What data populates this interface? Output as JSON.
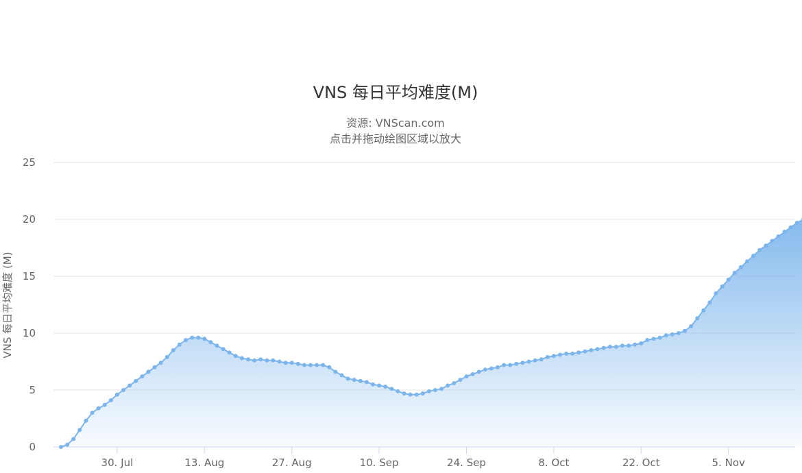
{
  "chart_data": {
    "type": "area",
    "title": "VNS 每日平均难度(M)",
    "subtitle_lines": [
      "资源: VNScan.com",
      "点击并拖动绘图区域以放大"
    ],
    "ylabel": "VNS 每日平均难度 (M)",
    "xlabel": "",
    "ylim": [
      0,
      25
    ],
    "yticks": [
      "0",
      "5",
      "10",
      "15",
      "20",
      "25"
    ],
    "xticks": [
      {
        "label": "30. Jul",
        "day": 9
      },
      {
        "label": "13. Aug",
        "day": 23
      },
      {
        "label": "27. Aug",
        "day": 37
      },
      {
        "label": "10. Sep",
        "day": 51
      },
      {
        "label": "24. Sep",
        "day": 65
      },
      {
        "label": "8. Oct",
        "day": 79
      },
      {
        "label": "22. Oct",
        "day": 93
      },
      {
        "label": "5. Nov",
        "day": 107
      }
    ],
    "grid": true,
    "legend": "none",
    "series": [
      {
        "values": [
          0.0,
          0.2,
          0.7,
          1.5,
          2.3,
          3.0,
          3.4,
          3.7,
          4.1,
          4.6,
          5.0,
          5.4,
          5.8,
          6.2,
          6.6,
          7.0,
          7.4,
          7.9,
          8.5,
          9.0,
          9.4,
          9.6,
          9.6,
          9.5,
          9.2,
          8.9,
          8.6,
          8.3,
          8.0,
          7.8,
          7.7,
          7.6,
          7.7,
          7.6,
          7.6,
          7.5,
          7.4,
          7.4,
          7.3,
          7.2,
          7.2,
          7.2,
          7.2,
          7.0,
          6.6,
          6.3,
          6.0,
          5.9,
          5.8,
          5.7,
          5.5,
          5.4,
          5.3,
          5.1,
          4.9,
          4.7,
          4.6,
          4.6,
          4.7,
          4.9,
          5.0,
          5.1,
          5.4,
          5.6,
          5.9,
          6.2,
          6.4,
          6.6,
          6.8,
          6.9,
          7.0,
          7.2,
          7.2,
          7.3,
          7.4,
          7.5,
          7.6,
          7.7,
          7.9,
          8.0,
          8.1,
          8.2,
          8.2,
          8.3,
          8.4,
          8.5,
          8.6,
          8.7,
          8.8,
          8.8,
          8.9,
          8.9,
          9.0,
          9.1,
          9.4,
          9.5,
          9.6,
          9.8,
          9.9,
          10.0,
          10.2,
          10.6,
          11.3,
          12.0,
          12.7,
          13.5,
          14.1,
          14.7,
          15.3,
          15.8,
          16.3,
          16.8,
          17.3,
          17.7,
          18.1,
          18.5,
          18.9,
          19.3,
          19.7,
          20.0,
          20.3,
          20.6
        ],
        "color": "#7cb5ec"
      }
    ],
    "colors": {
      "line": "#7cb5ec",
      "area_top": "#7cb5ec",
      "grid": "#e6e6e6",
      "axis": "#ccd6eb"
    }
  }
}
